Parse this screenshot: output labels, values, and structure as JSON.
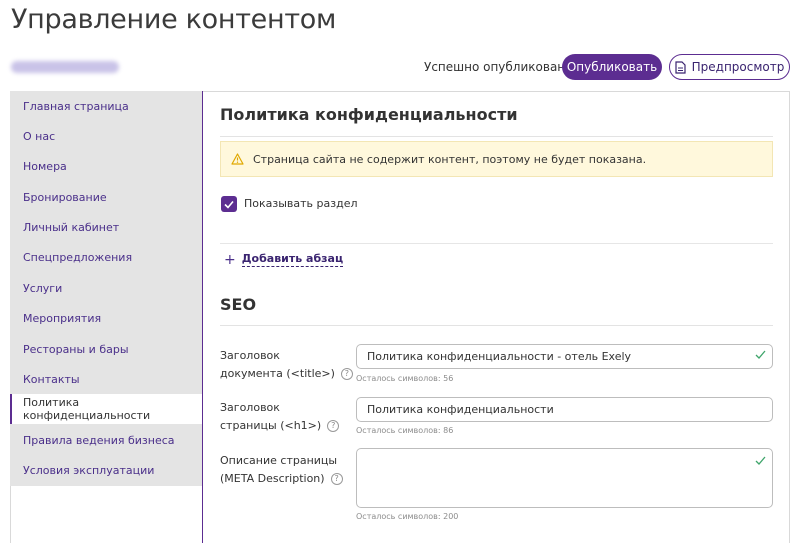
{
  "header": {
    "title": "Управление контентом",
    "status": "Успешно опубликовано",
    "publish_label": "Опубликовать",
    "preview_label": "Предпросмотр"
  },
  "sidebar": {
    "items": [
      {
        "label": "Главная страница"
      },
      {
        "label": "О нас"
      },
      {
        "label": "Номера"
      },
      {
        "label": "Бронирование"
      },
      {
        "label": "Личный кабинет"
      },
      {
        "label": "Спецпредложения"
      },
      {
        "label": "Услуги"
      },
      {
        "label": "Мероприятия"
      },
      {
        "label": "Рестораны и бары"
      },
      {
        "label": "Контакты"
      },
      {
        "label": "Политика конфиденциальности",
        "active": true
      },
      {
        "label": "Правила ведения бизнеса"
      },
      {
        "label": "Условия эксплуатации"
      }
    ]
  },
  "main": {
    "section_title": "Политика конфиденциальности",
    "alert_text": "Страница сайта не содержит контент, поэтому не будет показана.",
    "show_section_label": "Показывать раздел",
    "show_section_checked": true,
    "add_paragraph_label": "Добавить абзац",
    "seo_title": "SEO",
    "fields": {
      "doc_title": {
        "label_line1": "Заголовок",
        "label_line2": "документа (<title>)",
        "value": "Политика конфиденциальности - отель Exely",
        "counter": "Осталось символов: 56"
      },
      "page_heading": {
        "label_line1": "Заголовок",
        "label_line2": "страницы (<h1>)",
        "value": "Политика конфиденциальности",
        "counter": "Осталось символов: 86"
      },
      "meta_description": {
        "label_line1": "Описание страницы",
        "label_line2": "(META Description)",
        "value": "",
        "counter": "Осталось символов: 200"
      }
    },
    "help_glyph": "?"
  },
  "colors": {
    "accent": "#5c2d91",
    "sidebar_bg": "#e4e4e4",
    "alert_bg": "#fff8dc",
    "valid_check": "#3fa56b"
  }
}
